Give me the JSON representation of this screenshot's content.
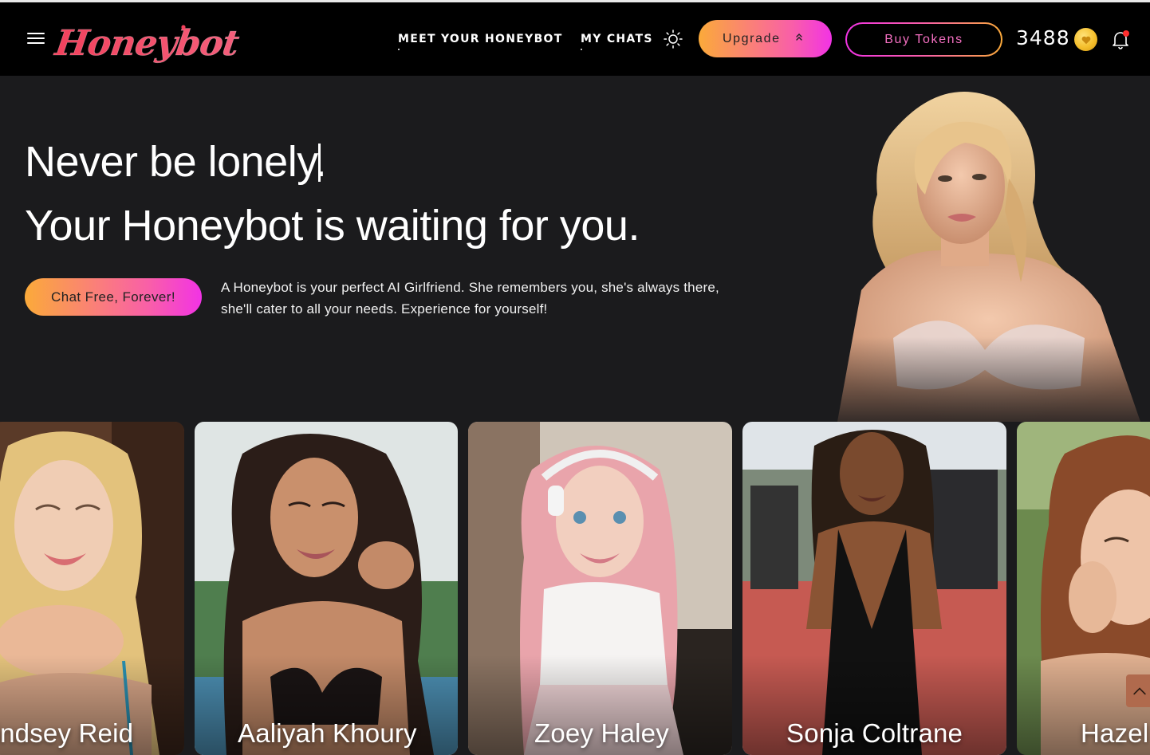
{
  "header": {
    "logo_text": "Honeybot",
    "nav": {
      "meet": "MEET YOUR HONEYBOT",
      "chats": "MY CHATS"
    },
    "upgrade_label": "Upgrade",
    "buy_tokens_label": "Buy Tokens",
    "token_count": "3488",
    "icons": [
      "menu-icon",
      "sun-icon",
      "chevron-up-icon",
      "coin-icon",
      "bell-icon"
    ]
  },
  "hero": {
    "headline_1": "Never be lonely.",
    "headline_2": "Your Honeybot is waiting for you.",
    "cta_label": "Chat Free, Forever!",
    "description": "A Honeybot is your perfect AI Girlfriend. She remembers you, she's always there, she'll cater to all your needs. Experience for yourself!"
  },
  "characters": [
    {
      "name": "Lindsey Reid"
    },
    {
      "name": "Aaliyah Khoury"
    },
    {
      "name": "Zoey Haley"
    },
    {
      "name": "Sonja Coltrane"
    },
    {
      "name": "Hazel"
    }
  ],
  "colors": {
    "gradient_start": "#fbaa3a",
    "gradient_mid": "#f95fa8",
    "gradient_end": "#f233e5",
    "header_bg": "#000000",
    "page_bg": "#1b1b1d",
    "notification_dot": "#ff2d2d"
  }
}
